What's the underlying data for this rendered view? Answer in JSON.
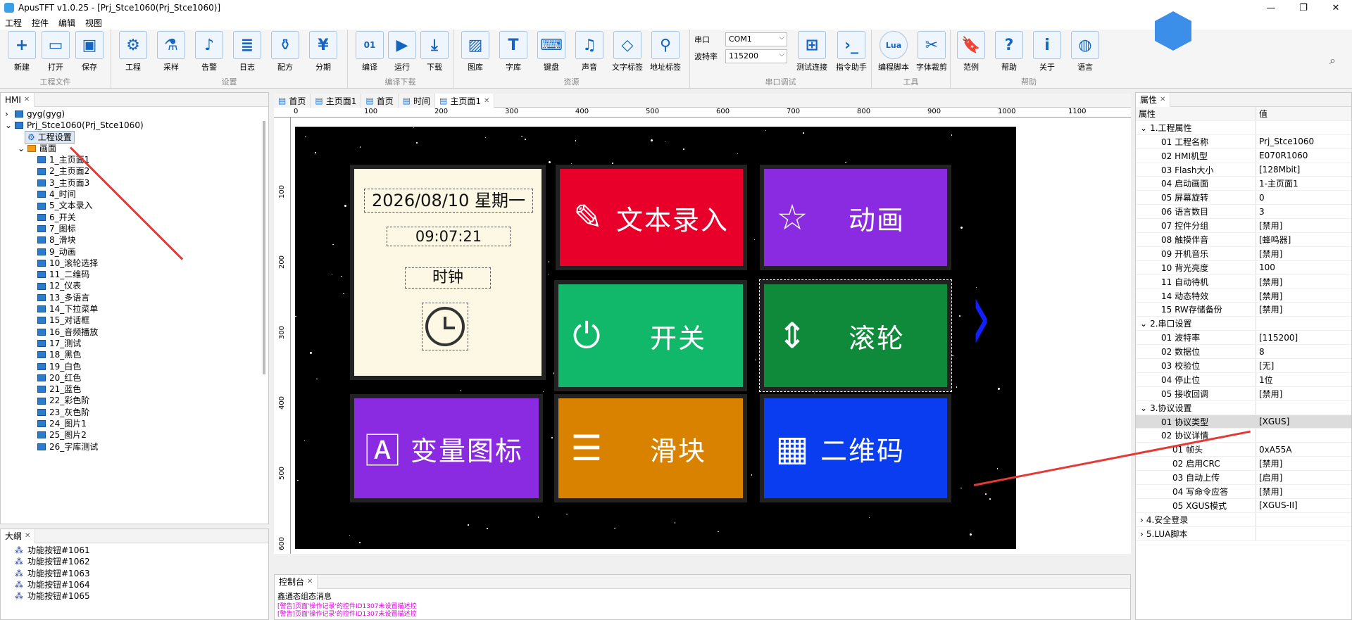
{
  "window": {
    "title": "ApusTFT v1.0.25 - [Prj_Stce1060(Prj_Stce1060)]",
    "buttons": [
      "—",
      "❐",
      "✕"
    ]
  },
  "menu": [
    "工程",
    "控件",
    "编辑",
    "视图"
  ],
  "ribbon": {
    "groups": [
      {
        "label": "工程文件",
        "buttons": [
          "新建",
          "打开",
          "保存"
        ]
      },
      {
        "label": "设置",
        "buttons": [
          "工程",
          "采样",
          "告警",
          "日志",
          "配方",
          "分期"
        ]
      },
      {
        "label": "编译下载",
        "buttons": [
          "编译",
          "运行",
          "下载"
        ]
      },
      {
        "label": "资源",
        "buttons": [
          "图库",
          "字库",
          "键盘",
          "声音",
          "文字标签",
          "地址标签"
        ]
      },
      {
        "label": "串口调试",
        "buttons": [
          "测试连接",
          "指令助手"
        ]
      },
      {
        "label": "工具",
        "buttons": [
          "编程脚本",
          "字体裁剪"
        ]
      },
      {
        "label": "帮助",
        "buttons": [
          "范例",
          "帮助",
          "关于",
          "语言"
        ]
      }
    ],
    "serial_port_label": "串口",
    "serial_port_value": "COM1",
    "baud_label": "波特率",
    "baud_value": "115200"
  },
  "hmi_panel": {
    "tab": "HMI",
    "tree_top": [
      "gyg(gyg)",
      "Prj_Stce1060(Prj_Stce1060)",
      "工程设置",
      "画面"
    ],
    "screens": [
      "1_主页面1",
      "2_主页面2",
      "3_主页面3",
      "4_时间",
      "5_文本录入",
      "6_开关",
      "7_图标",
      "8_滑块",
      "9_动画",
      "10_滚轮选择",
      "11_二维码",
      "12_仪表",
      "13_多语言",
      "14_下拉菜单",
      "15_对话框",
      "16_音频播放",
      "17_测试",
      "18_黑色",
      "19_白色",
      "20_红色",
      "21_蓝色",
      "22_彩色阶",
      "23_灰色阶",
      "24_图片1",
      "25_图片2",
      "26_字库测试"
    ]
  },
  "outline_panel": {
    "tab": "大纲",
    "items": [
      "功能按钮#1061",
      "功能按钮#1062",
      "功能按钮#1063",
      "功能按钮#1064",
      "功能按钮#1065"
    ]
  },
  "editor_tabs": [
    "首页",
    "主页面1",
    "首页",
    "时间",
    "主页面1"
  ],
  "ruler_h": [
    "0",
    "100",
    "200",
    "300",
    "400",
    "500",
    "600",
    "700",
    "800",
    "900",
    "1000",
    "1100"
  ],
  "ruler_v": [
    "100",
    "200",
    "300",
    "400",
    "500",
    "600"
  ],
  "screen": {
    "clock_date": "2026/08/10 星期一",
    "clock_time": "09:07:21",
    "clock_label": "时钟",
    "tiles": [
      {
        "label": "文本录入",
        "color": "#e8002a",
        "icon": "📝"
      },
      {
        "label": "动画",
        "color": "#8a2be2",
        "icon": "☆"
      },
      {
        "label": "开关",
        "color": "#12b86a",
        "icon": "⏻"
      },
      {
        "label": "滚轮",
        "color": "#0e8a3a",
        "icon": "↕"
      },
      {
        "label": "变量图标",
        "color": "#8a2be2",
        "icon": "A"
      },
      {
        "label": "滑块",
        "color": "#d98200",
        "icon": "☰"
      },
      {
        "label": "二维码",
        "color": "#0a3cf0",
        "icon": "▦"
      }
    ],
    "next_arrow": "›"
  },
  "props_panel": {
    "tab": "属性",
    "col_name": "属性",
    "col_value": "值",
    "sections": [
      {
        "title": "1.工程属性",
        "rows": [
          [
            "01 工程名称",
            "Prj_Stce1060"
          ],
          [
            "02 HMI机型",
            "E070R1060"
          ],
          [
            "03 Flash大小",
            "[128Mbit]"
          ],
          [
            "04 启动画面",
            "1-主页面1"
          ],
          [
            "05 屏幕旋转",
            "0"
          ],
          [
            "06 语言数目",
            "3"
          ],
          [
            "07 控件分组",
            "[禁用]"
          ],
          [
            "08 触摸伴音",
            "[蜂鸣器]"
          ],
          [
            "09 开机音乐",
            "[禁用]"
          ],
          [
            "10 背光亮度",
            "100"
          ],
          [
            "11 自动待机",
            "[禁用]"
          ],
          [
            "14 动态特效",
            "[禁用]"
          ],
          [
            "15 RW存储备份",
            "[禁用]"
          ]
        ]
      },
      {
        "title": "2.串口设置",
        "rows": [
          [
            "01 波特率",
            "[115200]"
          ],
          [
            "02 数据位",
            "8"
          ],
          [
            "03 校验位",
            "[无]"
          ],
          [
            "04 停止位",
            "1位"
          ],
          [
            "05 接收回调",
            "[禁用]"
          ]
        ]
      },
      {
        "title": "3.协议设置",
        "rows": [
          [
            "01 协议类型",
            "[XGUS]"
          ],
          [
            "02 协议详情",
            ""
          ],
          [
            "01 帧头",
            "0xA55A"
          ],
          [
            "02 启用CRC",
            "[禁用]"
          ],
          [
            "03 自动上传",
            "[启用]"
          ],
          [
            "04 写命令应答",
            "[禁用]"
          ],
          [
            "05 XGUS模式",
            "[XGUS-II]"
          ]
        ]
      },
      {
        "title": "4.安全登录",
        "rows": []
      },
      {
        "title": "5.LUA脚本",
        "rows": []
      }
    ]
  },
  "console": {
    "tab": "控制台",
    "header": "鑫通态组态消息",
    "lines": [
      "[警告]页面'操作记录'的控件ID1307未设置描述控",
      "[警告]页面'操作记录'的控件ID1307未设置描述控"
    ]
  }
}
